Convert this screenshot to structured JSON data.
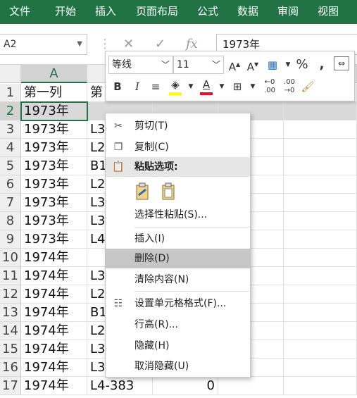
{
  "ribbon": {
    "tabs": [
      "文件",
      "开始",
      "插入",
      "页面布局",
      "公式",
      "数据",
      "审阅",
      "视图"
    ]
  },
  "formula_bar": {
    "name_box": "A2",
    "value": "1973年",
    "fx_label": "fx"
  },
  "mini_toolbar": {
    "font": "等线",
    "size": "11",
    "bold": "B",
    "italic": "I",
    "percent": "%",
    "comma": ","
  },
  "columns": [
    "A"
  ],
  "rows": [
    {
      "num": "1",
      "a": "第一列",
      "b": "第",
      "c": ""
    },
    {
      "num": "2",
      "a": "1973年",
      "b": "",
      "c": ""
    },
    {
      "num": "3",
      "a": "1973年",
      "b": "L3",
      "c": ""
    },
    {
      "num": "4",
      "a": "1973年",
      "b": "L2",
      "c": ""
    },
    {
      "num": "5",
      "a": "1973年",
      "b": "B1",
      "c": ""
    },
    {
      "num": "6",
      "a": "1973年",
      "b": "L2",
      "c": ""
    },
    {
      "num": "7",
      "a": "1973年",
      "b": "L3",
      "c": ""
    },
    {
      "num": "8",
      "a": "1973年",
      "b": "L3",
      "c": ""
    },
    {
      "num": "9",
      "a": "1973年",
      "b": "L4",
      "c": ""
    },
    {
      "num": "10",
      "a": "1974年",
      "b": "",
      "c": ""
    },
    {
      "num": "11",
      "a": "1974年",
      "b": "L3",
      "c": ""
    },
    {
      "num": "12",
      "a": "1974年",
      "b": "L2",
      "c": ""
    },
    {
      "num": "13",
      "a": "1974年",
      "b": "B1",
      "c": ""
    },
    {
      "num": "14",
      "a": "1974年",
      "b": "L2",
      "c": ""
    },
    {
      "num": "15",
      "a": "1974年",
      "b": "L3",
      "c": ""
    },
    {
      "num": "16",
      "a": "1974年",
      "b": "L3",
      "c": ""
    },
    {
      "num": "17",
      "a": "1974年",
      "b": "L4-383",
      "c": "0"
    }
  ],
  "context_menu": {
    "cut": "剪切(T)",
    "copy": "复制(C)",
    "paste_options": "粘贴选项:",
    "paste_special": "选择性粘贴(S)...",
    "insert": "插入(I)",
    "delete": "删除(D)",
    "clear": "清除内容(N)",
    "format_cells": "设置单元格格式(F)...",
    "row_height": "行高(R)...",
    "hide": "隐藏(H)",
    "unhide": "取消隐藏(U)"
  },
  "colors": {
    "ribbon": "#217346",
    "font_color": "#e81123",
    "highlight": "#ffff00"
  }
}
